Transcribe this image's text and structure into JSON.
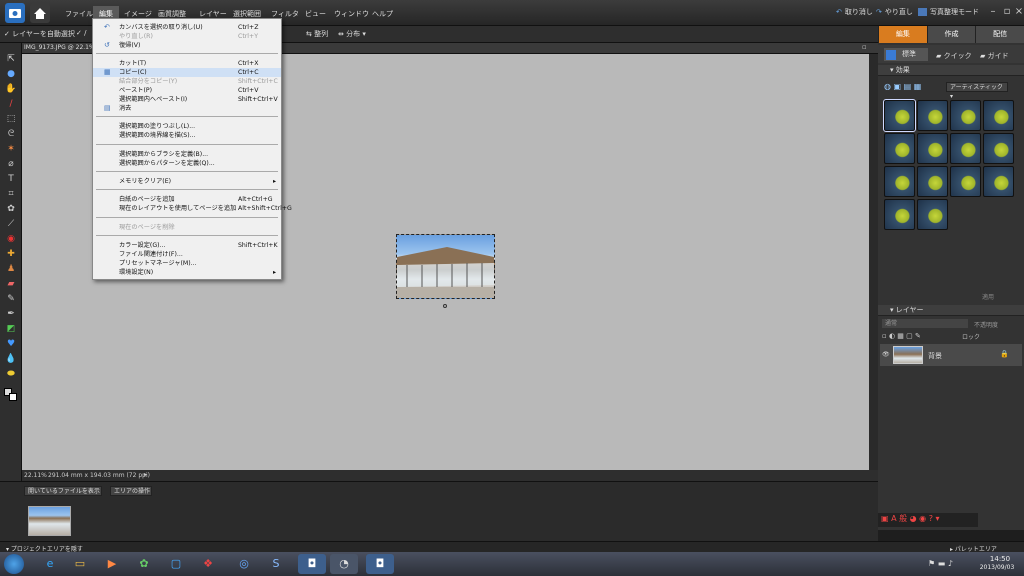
{
  "menubar": {
    "items": [
      "ファイル",
      "編集",
      "イメージ",
      "画質調整",
      "レイヤー",
      "選択範囲",
      "フィルタ",
      "ビュー",
      "ウィンドウ",
      "ヘルプ"
    ],
    "undo": "取り消し",
    "redo": "やり直し",
    "organizer": "写真整理モード"
  },
  "options": {
    "auto_select": "レイヤーを自動選択",
    "arrange": "整列",
    "distribute": "分布"
  },
  "mode_tabs": [
    "編集",
    "作成",
    "配信"
  ],
  "doc_tab": "IMG_9173.JPG @ 22.1%(R",
  "edit_menu": {
    "items": [
      {
        "label": "カンバスを選択の取り消し(U)",
        "shortcut": "Ctrl+Z",
        "disabled": false
      },
      {
        "label": "やり直し(R)",
        "shortcut": "Ctrl+Y",
        "disabled": true
      },
      {
        "label": "復帰(V)",
        "shortcut": "",
        "disabled": false
      },
      {
        "label": "カット(T)",
        "shortcut": "Ctrl+X",
        "disabled": false
      },
      {
        "label": "コピー(C)",
        "shortcut": "Ctrl+C",
        "disabled": false
      },
      {
        "label": "結合部分をコピー(Y)",
        "shortcut": "Shift+Ctrl+C",
        "disabled": true
      },
      {
        "label": "ペースト(P)",
        "shortcut": "Ctrl+V",
        "disabled": false
      },
      {
        "label": "選択範囲内へペースト(I)",
        "shortcut": "Shift+Ctrl+V",
        "disabled": false
      },
      {
        "label": "消去",
        "shortcut": "",
        "disabled": false
      },
      {
        "label": "選択範囲の塗りつぶし(L)...",
        "shortcut": "",
        "disabled": false
      },
      {
        "label": "選択範囲の境界線を描(S)...",
        "shortcut": "",
        "disabled": false
      },
      {
        "label": "選択範囲からブラシを定義(B)...",
        "shortcut": "",
        "disabled": false
      },
      {
        "label": "選択範囲からパターンを定義(Q)...",
        "shortcut": "",
        "disabled": false
      },
      {
        "label": "メモリをクリア(E)",
        "shortcut": "",
        "disabled": false
      },
      {
        "label": "白紙のページを追加",
        "shortcut": "Alt+Ctrl+G",
        "disabled": false
      },
      {
        "label": "現在のレイアウトを使用してページを追加",
        "shortcut": "Alt+Shift+Ctrl+G",
        "disabled": false
      },
      {
        "label": "現在のページを削除",
        "shortcut": "",
        "disabled": true
      },
      {
        "label": "カラー設定(G)...",
        "shortcut": "Shift+Ctrl+K",
        "disabled": false
      },
      {
        "label": "ファイル関連付け(F)...",
        "shortcut": "",
        "disabled": false
      },
      {
        "label": "プリセットマネージャ(M)...",
        "shortcut": "",
        "disabled": false
      },
      {
        "label": "環境設定(N)",
        "shortcut": "",
        "disabled": false
      }
    ]
  },
  "status": {
    "zoom": "22.11%",
    "size": "291.04 mm x 194.03 mm (72 ppi)"
  },
  "project_bin": {
    "dropdown": "開いているファイルを表示",
    "actions": "エリアの操作",
    "hide": "プロジェクトエリアを隠す"
  },
  "panel": {
    "tabs": [
      "標準",
      "クイック",
      "ガイド"
    ],
    "effects_title": "効果",
    "effects_filter": "アーティスティック",
    "apply": "適用",
    "layers_title": "レイヤー",
    "blend": "通常",
    "opacity": "不透明度",
    "lock": "ロック",
    "layer_name": "背景",
    "palette_bin": "パレットエリア"
  },
  "taskbar": {
    "time": "14:50",
    "date": "2013/09/03"
  }
}
